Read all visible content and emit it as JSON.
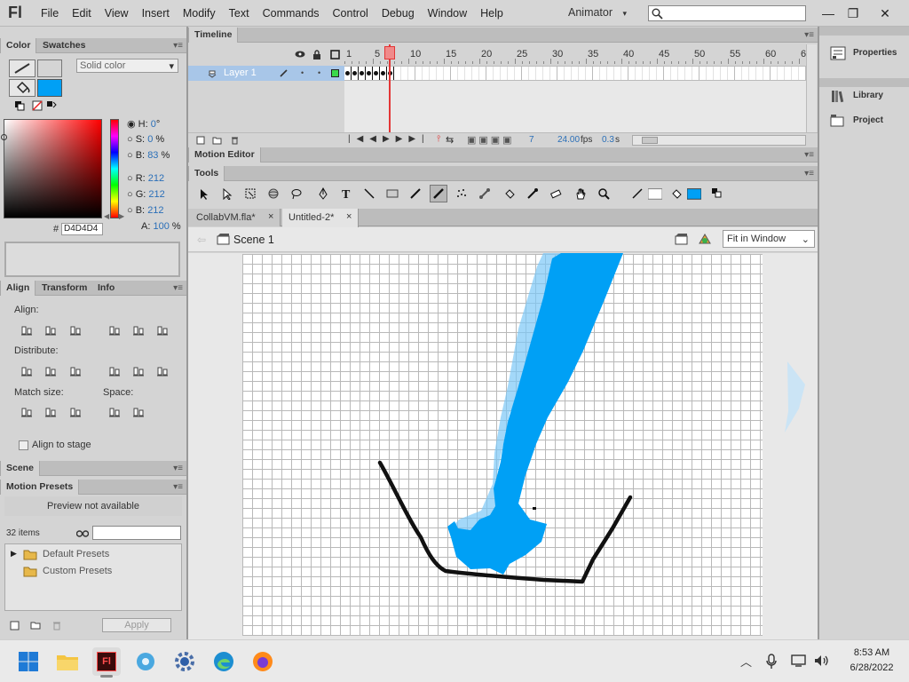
{
  "app": {
    "logo": "Fl",
    "menu": [
      "File",
      "Edit",
      "View",
      "Insert",
      "Modify",
      "Text",
      "Commands",
      "Control",
      "Debug",
      "Window",
      "Help"
    ],
    "workspace": "Animator",
    "workspace_arrow": "▾"
  },
  "window_controls": {
    "minimize": "—",
    "restore": "❐",
    "close": "✕"
  },
  "color_panel": {
    "tabs": [
      "Color",
      "Swatches"
    ],
    "fill_type": "Solid color",
    "fill_color": "#00A0F5",
    "stroke_color": "#D4D4D4",
    "hsb": [
      {
        "label": "H:",
        "value": "0",
        "unit": "°"
      },
      {
        "label": "S:",
        "value": "0",
        "unit": "%"
      },
      {
        "label": "B:",
        "value": "83",
        "unit": "%"
      }
    ],
    "rgb": [
      {
        "label": "R:",
        "value": "212"
      },
      {
        "label": "G:",
        "value": "212"
      },
      {
        "label": "B:",
        "value": "212"
      }
    ],
    "alpha": {
      "label": "A:",
      "value": "100",
      "unit": "%"
    },
    "hex_label": "#",
    "hex_value": "D4D4D4"
  },
  "align_panel": {
    "tabs": [
      "Align",
      "Transform",
      "Info"
    ],
    "align_label": "Align:",
    "distribute_label": "Distribute:",
    "match_size_label": "Match size:",
    "space_label": "Space:",
    "align_to_stage": "Align to stage"
  },
  "scene_panel": {
    "title": "Scene"
  },
  "motion_presets": {
    "title": "Motion Presets",
    "preview": "Preview not available",
    "count": "32 items",
    "folders": [
      "Default Presets",
      "Custom Presets"
    ],
    "apply": "Apply"
  },
  "timeline": {
    "title": "Timeline",
    "layer": "Layer 1",
    "ruler": [
      "1",
      "5",
      "10",
      "15",
      "20",
      "25",
      "30",
      "35",
      "40",
      "45",
      "50",
      "55",
      "60",
      "6"
    ],
    "current_frame": "7",
    "fps": "24.00",
    "fps_unit": "fps",
    "time": "0.3",
    "time_unit": "s"
  },
  "motion_editor": {
    "title": "Motion Editor"
  },
  "tools_panel": {
    "title": "Tools"
  },
  "documents": {
    "tabs": [
      "CollabVM.fla*",
      "Untitled-2*"
    ],
    "close": "×",
    "scene": "Scene 1",
    "zoom": "Fit in Window"
  },
  "right_panel": {
    "items": [
      "Properties",
      "Library",
      "Project"
    ]
  },
  "taskbar": {
    "time": "8:53 AM",
    "date": "6/28/2022"
  },
  "colors": {
    "accent": "#00A0F5",
    "selection": "#A8C6E8",
    "playhead": "#E33636"
  }
}
